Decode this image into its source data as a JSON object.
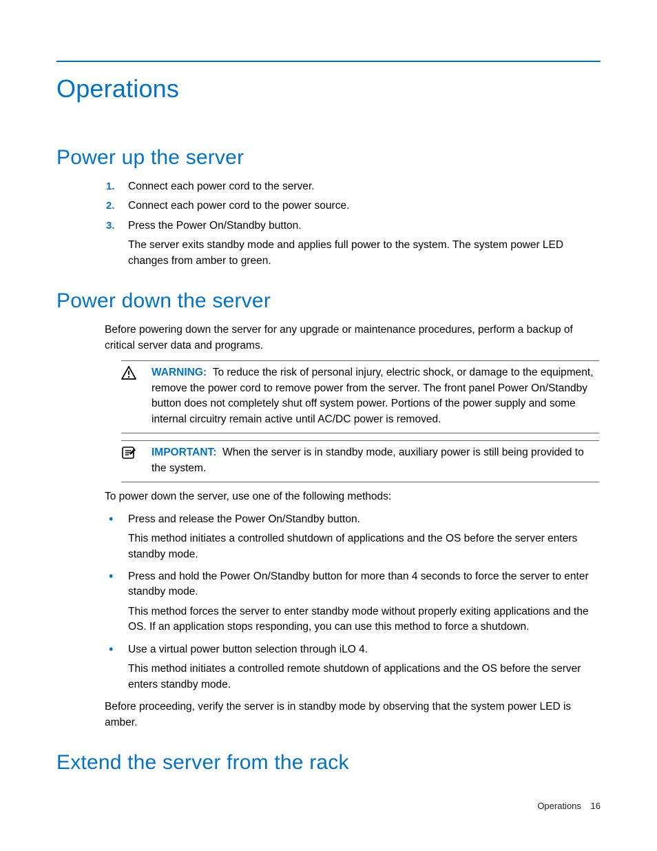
{
  "title": "Operations",
  "sections": {
    "power_up": {
      "heading": "Power up the server",
      "steps": [
        {
          "num": "1.",
          "text": "Connect each power cord to the server."
        },
        {
          "num": "2.",
          "text": "Connect each power cord to the power source."
        },
        {
          "num": "3.",
          "text": "Press the Power On/Standby button.",
          "after": "The server exits standby mode and applies full power to the system. The system power LED changes from amber to green."
        }
      ]
    },
    "power_down": {
      "heading": "Power down the server",
      "intro": "Before powering down the server for any upgrade or maintenance procedures, perform a backup of critical server data and programs.",
      "warning_label": "WARNING:",
      "warning_text": "To reduce the risk of personal injury, electric shock, or damage to the equipment, remove the power cord to remove power from the server. The front panel Power On/Standby button does not completely shut off system power. Portions of the power supply and some internal circuitry remain active until AC/DC power is removed.",
      "important_label": "IMPORTANT:",
      "important_text": "When the server is in standby mode, auxiliary power is still being provided to the system.",
      "methods_intro": "To power down the server, use one of the following methods:",
      "methods": [
        {
          "lead": "Press and release the Power On/Standby button.",
          "detail": "This method initiates a controlled shutdown of applications and the OS before the server enters standby mode."
        },
        {
          "lead": "Press and hold the Power On/Standby button for more than 4 seconds to force the server to enter standby mode.",
          "detail": "This method forces the server to enter standby mode without properly exiting applications and the OS. If an application stops responding, you can use this method to force a shutdown."
        },
        {
          "lead": "Use a virtual power button selection through iLO 4.",
          "detail": "This method initiates a controlled remote shutdown of applications and the OS before the server enters standby mode."
        }
      ],
      "outro": "Before proceeding, verify the server is in standby mode by observing that the system power LED is amber."
    },
    "extend": {
      "heading": "Extend the server from the rack"
    }
  },
  "footer": {
    "section": "Operations",
    "page": "16"
  }
}
